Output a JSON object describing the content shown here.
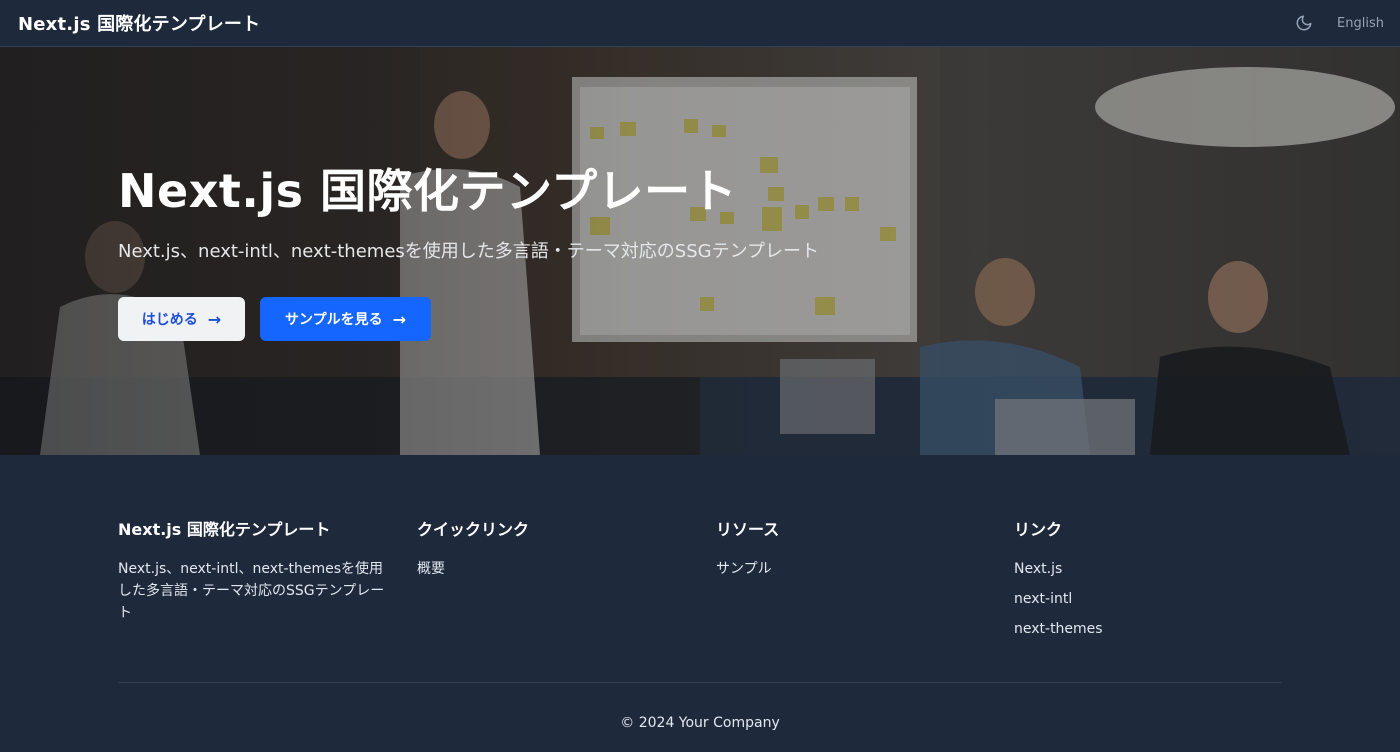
{
  "header": {
    "brand": "Next.js 国際化テンプレート",
    "theme_icon": "moon-icon",
    "language": "English"
  },
  "hero": {
    "title": "Next.js 国際化テンプレート",
    "subtitle": "Next.js、next-intl、next-themesを使用した多言語・テーマ対応のSSGテンプレート",
    "buttons": [
      {
        "label": "はじめる",
        "icon": "arrow-right-icon"
      },
      {
        "label": "サンプルを見る",
        "icon": "arrow-right-icon"
      }
    ]
  },
  "footer": {
    "about": {
      "title": "Next.js 国際化テンプレート",
      "description": "Next.js、next-intl、next-themesを使用した多言語・テーマ対応のSSGテンプレート"
    },
    "quick_links": {
      "title": "クイックリンク",
      "items": [
        "概要"
      ]
    },
    "resources": {
      "title": "リソース",
      "items": [
        "サンプル"
      ]
    },
    "links": {
      "title": "リンク",
      "items": [
        "Next.js",
        "next-intl",
        "next-themes"
      ]
    },
    "copyright": "© 2024 Your Company"
  },
  "colors": {
    "background": "#1e293b",
    "primary_button": "#1565ff",
    "light_button": "#f1f2f4",
    "light_button_text": "#1d4ed8"
  }
}
